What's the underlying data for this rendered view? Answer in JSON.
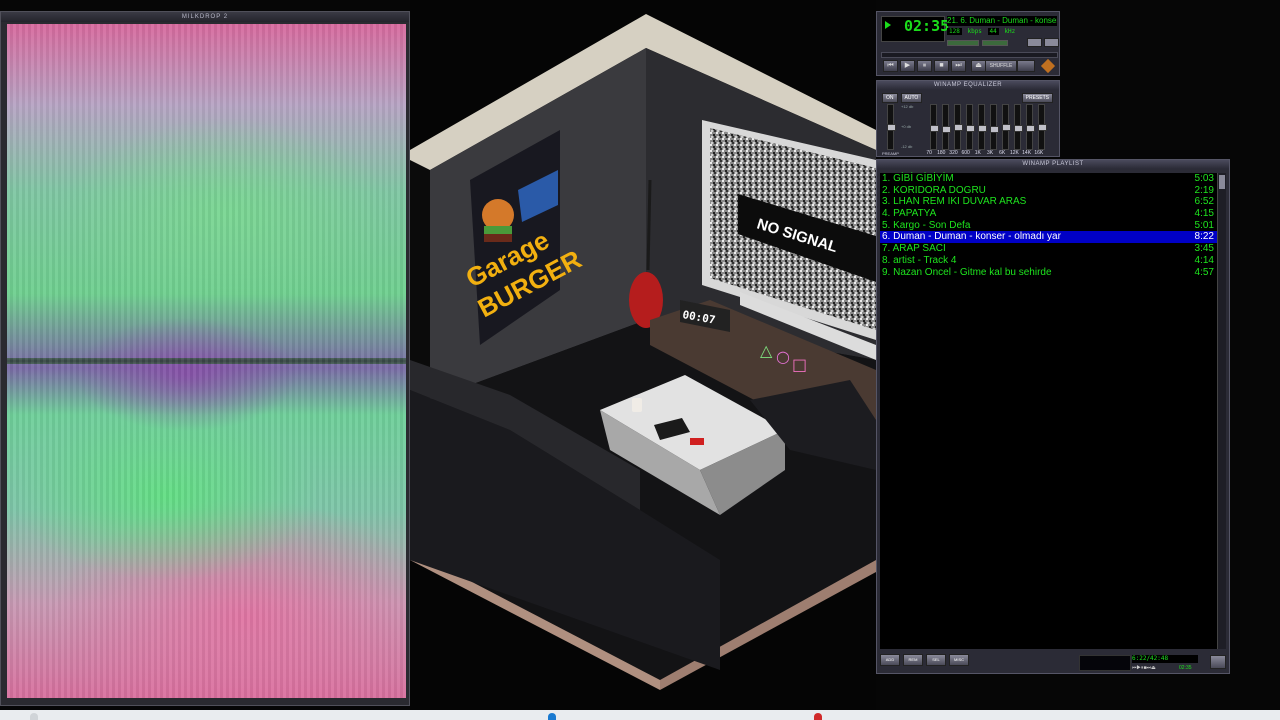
{
  "milkdrop": {
    "title": "MILKDROP 2"
  },
  "scene": {
    "poster_line1": "Garage",
    "poster_line2": "BURGER",
    "tv_text": "NO SIGNAL",
    "clock": "00:07"
  },
  "winamp_main": {
    "time": "02:35",
    "marquee": "21. 6. Duman - Duman - konser - olmadi yar",
    "kbps": "128",
    "kbps_unit": "kbps",
    "khz": "44",
    "khz_unit": "kHz",
    "shuffle_label": "SHUFFLE"
  },
  "equalizer": {
    "title": "WINAMP EQUALIZER",
    "on_label": "ON",
    "auto_label": "AUTO",
    "presets_label": "PRESETS",
    "preamp_label": "PREAMP",
    "db_top": "+12 db",
    "db_mid": "+0 db",
    "db_bottom": "-12 db",
    "frequencies": [
      "70",
      "180",
      "320",
      "600",
      "1K",
      "3K",
      "6K",
      "12K",
      "14K",
      "16K"
    ]
  },
  "playlist": {
    "title": "WINAMP PLAYLIST",
    "items": [
      {
        "label": "1. GİBİ GİBİYİM",
        "time": "5:03"
      },
      {
        "label": "2. KORIDORA DOGRU",
        "time": "2:19"
      },
      {
        "label": "3.  LHAN  REM   IKI DUVAR ARAS",
        "time": "6:52"
      },
      {
        "label": "4. PAPATYA",
        "time": "4:15"
      },
      {
        "label": "5. Kargo - Son Defa",
        "time": "5:01"
      },
      {
        "label": "6. Duman - Duman  - konser - olmadı yar",
        "time": "8:22"
      },
      {
        "label": "7. ARAP SACI",
        "time": "3:45"
      },
      {
        "label": "8. artist - Track 4",
        "time": "4:14"
      },
      {
        "label": "9. Nazan Oncel - Gitme kal bu sehirde",
        "time": "4:57"
      }
    ],
    "selected_index": 5,
    "buttons": [
      "ADD",
      "REM",
      "SEL",
      "MISC"
    ],
    "total_time": "6:22/42:48",
    "mini_time": "02:35"
  },
  "colors": {
    "playlist_text": "#1ee51e",
    "playlist_selected_bg": "#0000c6",
    "lcd_green": "#1bdc1b"
  }
}
